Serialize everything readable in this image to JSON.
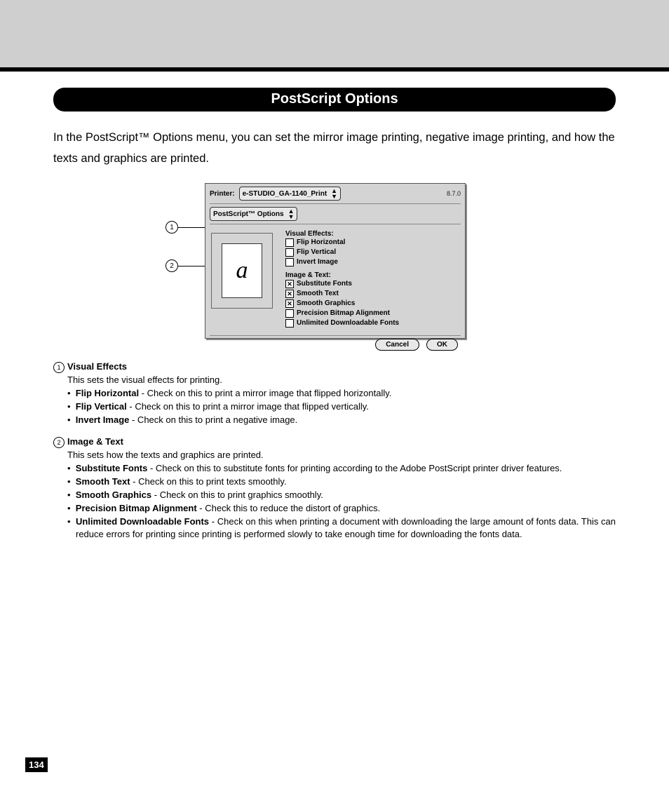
{
  "section_title": "PostScript Options",
  "intro": "In the PostScript™ Options menu, you can set the mirror image printing, negative image printing, and how the texts and graphics are printed.",
  "dialog": {
    "printer_label": "Printer:",
    "printer_value": "e-STUDIO_GA-1140_Print",
    "menu_value": "PostScript™ Options",
    "version": "8.7.0",
    "preview_glyph": "a",
    "group1_title": "Visual Effects:",
    "group1_items": [
      {
        "label": "Flip Horizontal",
        "checked": false
      },
      {
        "label": "Flip Vertical",
        "checked": false
      },
      {
        "label": "Invert Image",
        "checked": false
      }
    ],
    "group2_title": "Image & Text:",
    "group2_items": [
      {
        "label": "Substitute Fonts",
        "checked": true
      },
      {
        "label": "Smooth Text",
        "checked": true
      },
      {
        "label": "Smooth Graphics",
        "checked": true
      },
      {
        "label": "Precision Bitmap Alignment",
        "checked": false
      },
      {
        "label": "Unlimited Downloadable Fonts",
        "checked": false
      }
    ],
    "cancel": "Cancel",
    "ok": "OK"
  },
  "callouts": {
    "c1": "1",
    "c2": "2"
  },
  "desc1": {
    "num": "1",
    "title": "Visual Effects",
    "sub": "This sets the visual effects for printing.",
    "b1_head": "Flip Horizontal",
    "b1_tail": " - Check on this to print a mirror image that flipped horizontally.",
    "b2_head": "Flip Vertical",
    "b2_tail": " - Check on this to print a mirror image that flipped vertically.",
    "b3_head": "Invert Image",
    "b3_tail": " - Check on this to print a negative image."
  },
  "desc2": {
    "num": "2",
    "title": "Image & Text",
    "sub": "This sets how the texts and graphics are printed.",
    "b1_head": "Substitute Fonts",
    "b1_tail": " - Check on this to substitute fonts for printing according to the Adobe PostScript printer driver features.",
    "b2_head": "Smooth Text",
    "b2_tail": " - Check on this to print texts smoothly.",
    "b3_head": "Smooth Graphics",
    "b3_tail": " - Check on this to print graphics smoothly.",
    "b4_head": "Precision Bitmap Alignment",
    "b4_tail": " - Check this to reduce the distort of graphics.",
    "b5_head": "Unlimited Downloadable Fonts",
    "b5_tail": " - Check on this when printing a document with downloading the large amount of fonts data.  This can reduce errors for printing since printing is performed slowly to take enough time for downloading the fonts data."
  },
  "page_number": "134"
}
